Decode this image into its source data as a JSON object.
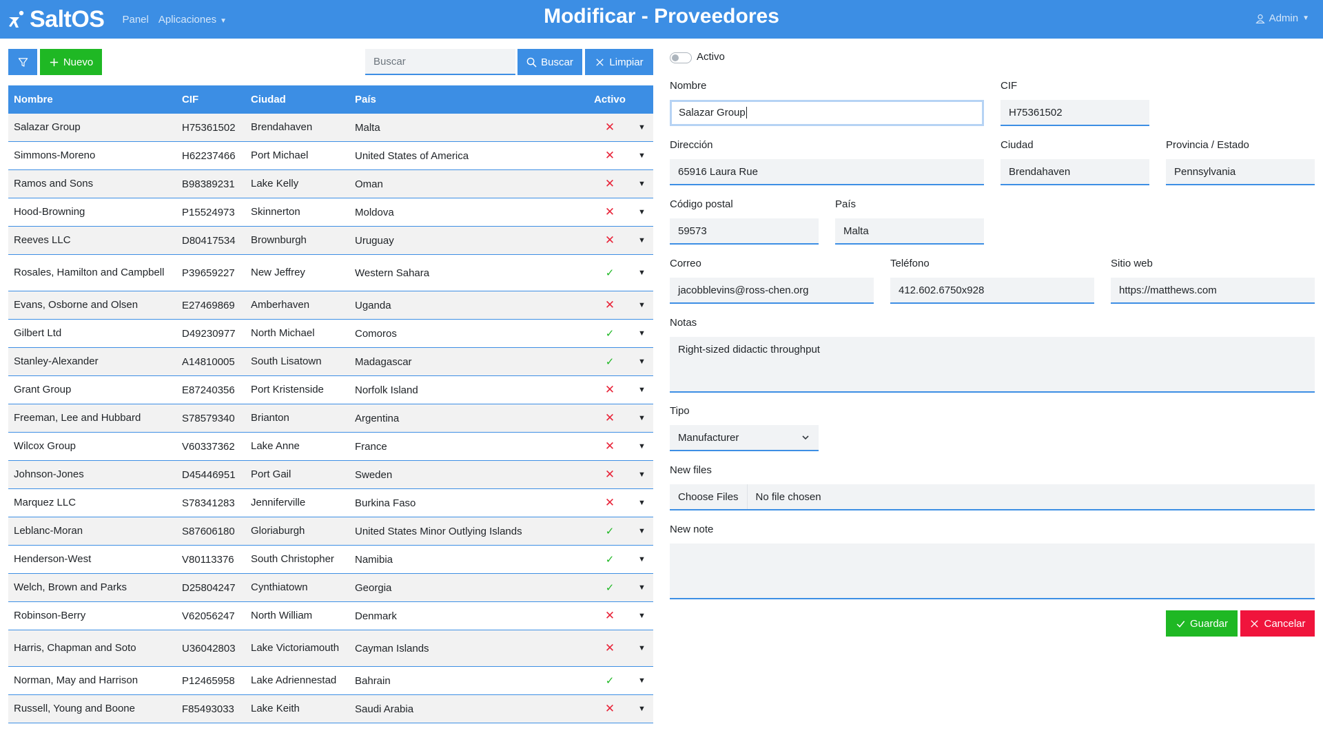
{
  "header": {
    "brand": "SaltOS",
    "nav": [
      {
        "label": "Panel"
      },
      {
        "label": "Aplicaciones"
      }
    ],
    "page_title": "Modificar - Proveedores",
    "user": "Admin"
  },
  "toolbar": {
    "filter_icon": "filter-icon",
    "new_label": "Nuevo",
    "search_placeholder": "Buscar",
    "search_label": "Buscar",
    "clear_label": "Limpiar"
  },
  "table": {
    "columns": {
      "name": "Nombre",
      "cif": "CIF",
      "city": "Ciudad",
      "country": "País",
      "active": "Activo"
    },
    "rows": [
      {
        "name": "Salazar Group",
        "cif": "H75361502",
        "city": "Brendahaven",
        "country": "Malta",
        "active": false
      },
      {
        "name": "Simmons-Moreno",
        "cif": "H62237466",
        "city": "Port Michael",
        "country": "United States of America",
        "active": false
      },
      {
        "name": "Ramos and Sons",
        "cif": "B98389231",
        "city": "Lake Kelly",
        "country": "Oman",
        "active": false
      },
      {
        "name": "Hood-Browning",
        "cif": "P15524973",
        "city": "Skinnerton",
        "country": "Moldova",
        "active": false
      },
      {
        "name": "Reeves LLC",
        "cif": "D80417534",
        "city": "Brownburgh",
        "country": "Uruguay",
        "active": false
      },
      {
        "name": "Rosales, Hamilton and Campbell",
        "cif": "P39659227",
        "city": "New Jeffrey",
        "country": "Western Sahara",
        "active": true
      },
      {
        "name": "Evans, Osborne and Olsen",
        "cif": "E27469869",
        "city": "Amberhaven",
        "country": "Uganda",
        "active": false
      },
      {
        "name": "Gilbert Ltd",
        "cif": "D49230977",
        "city": "North Michael",
        "country": "Comoros",
        "active": true
      },
      {
        "name": "Stanley-Alexander",
        "cif": "A14810005",
        "city": "South Lisatown",
        "country": "Madagascar",
        "active": true
      },
      {
        "name": "Grant Group",
        "cif": "E87240356",
        "city": "Port Kristenside",
        "country": "Norfolk Island",
        "active": false
      },
      {
        "name": "Freeman, Lee and Hubbard",
        "cif": "S78579340",
        "city": "Brianton",
        "country": "Argentina",
        "active": false
      },
      {
        "name": "Wilcox Group",
        "cif": "V60337362",
        "city": "Lake Anne",
        "country": "France",
        "active": false
      },
      {
        "name": "Johnson-Jones",
        "cif": "D45446951",
        "city": "Port Gail",
        "country": "Sweden",
        "active": false
      },
      {
        "name": "Marquez LLC",
        "cif": "S78341283",
        "city": "Jenniferville",
        "country": "Burkina Faso",
        "active": false
      },
      {
        "name": "Leblanc-Moran",
        "cif": "S87606180",
        "city": "Gloriaburgh",
        "country": "United States Minor Outlying Islands",
        "active": true
      },
      {
        "name": "Henderson-West",
        "cif": "V80113376",
        "city": "South Christopher",
        "country": "Namibia",
        "active": true
      },
      {
        "name": "Welch, Brown and Parks",
        "cif": "D25804247",
        "city": "Cynthiatown",
        "country": "Georgia",
        "active": true
      },
      {
        "name": "Robinson-Berry",
        "cif": "V62056247",
        "city": "North William",
        "country": "Denmark",
        "active": false
      },
      {
        "name": "Harris, Chapman and Soto",
        "cif": "U36042803",
        "city": "Lake Victoriamouth",
        "country": "Cayman Islands",
        "active": false
      },
      {
        "name": "Norman, May and Harrison",
        "cif": "P12465958",
        "city": "Lake Adriennestad",
        "country": "Bahrain",
        "active": true
      },
      {
        "name": "Russell, Young and Boone",
        "cif": "F85493033",
        "city": "Lake Keith",
        "country": "Saudi Arabia",
        "active": false
      }
    ]
  },
  "form": {
    "active_label": "Activo",
    "active": false,
    "name_label": "Nombre",
    "name_value": "Salazar Group",
    "cif_label": "CIF",
    "cif_value": "H75361502",
    "address_label": "Dirección",
    "address_value": "65916 Laura Rue",
    "city_label": "Ciudad",
    "city_value": "Brendahaven",
    "province_label": "Provincia / Estado",
    "province_value": "Pennsylvania",
    "zip_label": "Código postal",
    "zip_value": "59573",
    "country_label": "País",
    "country_value": "Malta",
    "email_label": "Correo",
    "email_value": "jacobblevins@ross-chen.org",
    "phone_label": "Teléfono",
    "phone_value": "412.602.6750x928",
    "web_label": "Sitio web",
    "web_value": "https://matthews.com",
    "notes_label": "Notas",
    "notes_value": "Right-sized didactic throughput",
    "type_label": "Tipo",
    "type_value": "Manufacturer",
    "files_label": "New files",
    "files_button": "Choose Files",
    "files_status": "No file chosen",
    "note_label": "New note",
    "note_value": "",
    "save_label": "Guardar",
    "cancel_label": "Cancelar"
  },
  "colors": {
    "primary": "#3c8ee4",
    "success": "#1fb824",
    "danger": "#f0143c"
  }
}
